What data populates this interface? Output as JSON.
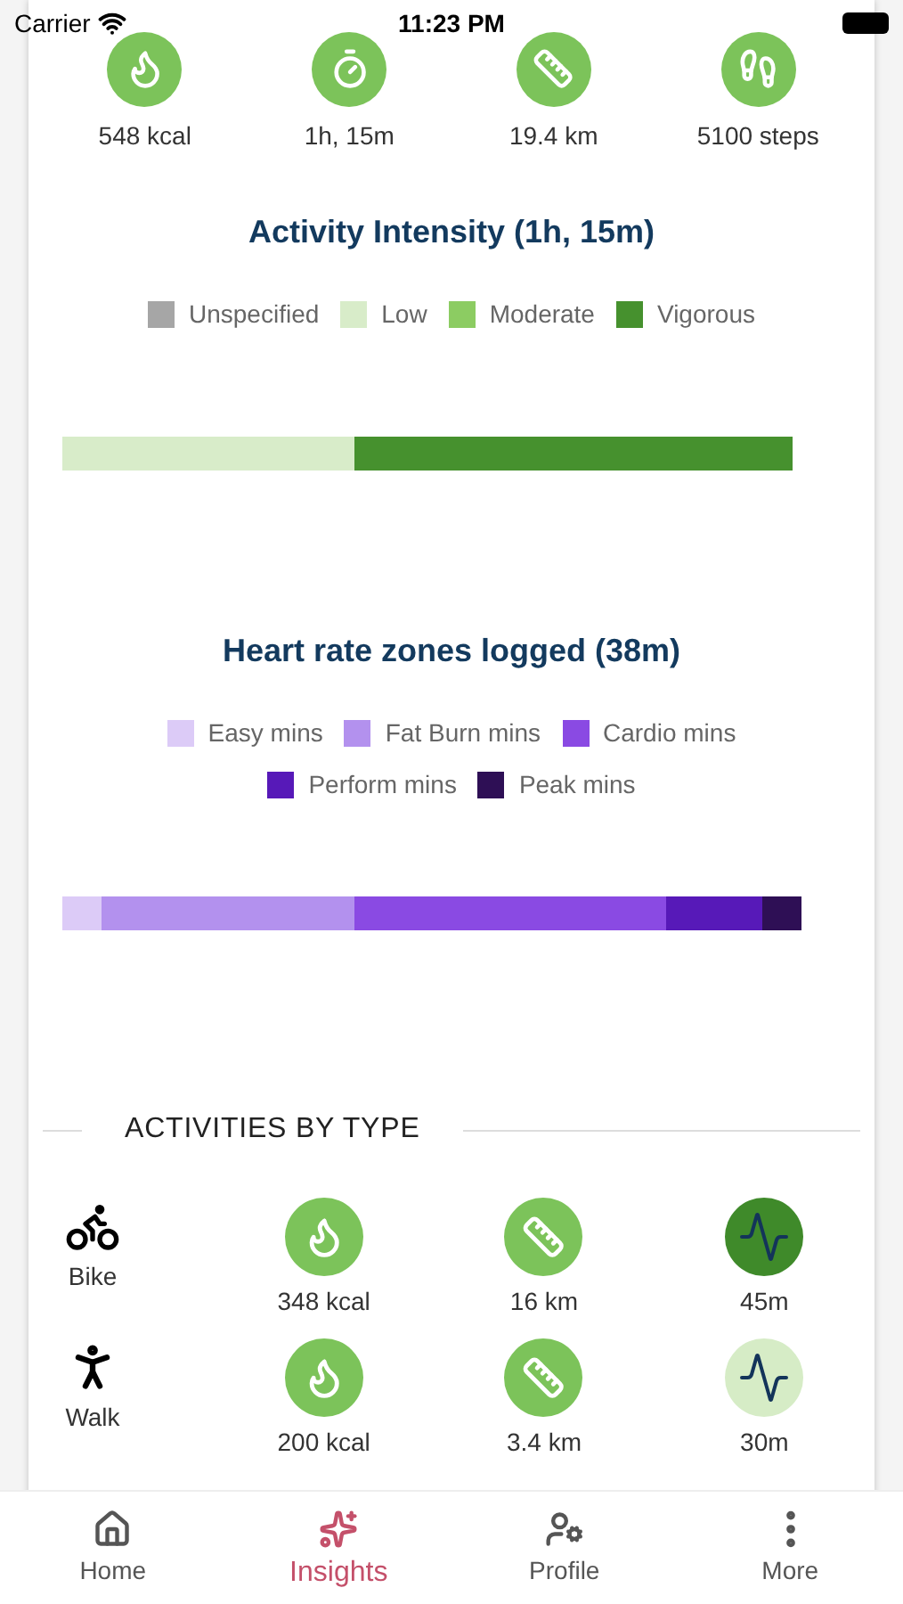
{
  "status_bar": {
    "carrier": "Carrier",
    "time": "11:23 PM"
  },
  "summary": [
    {
      "kind": "calories",
      "value": "548 kcal"
    },
    {
      "kind": "duration",
      "value": "1h, 15m"
    },
    {
      "kind": "distance",
      "value": "19.4 km"
    },
    {
      "kind": "steps",
      "value": "5100 steps"
    }
  ],
  "intensity": {
    "title": "Activity Intensity (1h, 15m)",
    "legend": [
      {
        "label": "Unspecified",
        "color": "#a6a6a6"
      },
      {
        "label": "Low",
        "color": "#d8ecc9"
      },
      {
        "label": "Moderate",
        "color": "#8ccc62"
      },
      {
        "label": "Vigorous",
        "color": "#46912e"
      }
    ]
  },
  "heart_rate": {
    "title": "Heart rate zones logged (38m)",
    "legend": [
      {
        "label": "Easy mins",
        "color": "#dccbf7"
      },
      {
        "label": "Fat Burn mins",
        "color": "#b391ee"
      },
      {
        "label": "Cardio mins",
        "color": "#8a4ae3"
      },
      {
        "label": "Perform mins",
        "color": "#5719b8"
      },
      {
        "label": "Peak mins",
        "color": "#2e0f55"
      }
    ]
  },
  "activities": {
    "title": "ACTIVITIES BY TYPE",
    "rows": [
      {
        "kind": "bike",
        "name": "Bike",
        "calories": "348 kcal",
        "distance": "16 km",
        "duration": "45m",
        "color": "#3f8a2a"
      },
      {
        "kind": "walk",
        "name": "Walk",
        "calories": "200 kcal",
        "distance": "3.4 km",
        "duration": "30m",
        "color": "#d6ecc6"
      }
    ]
  },
  "tabs": [
    {
      "kind": "home",
      "label": "Home",
      "selected": false
    },
    {
      "kind": "insights",
      "label": "Insights",
      "selected": true
    },
    {
      "kind": "profile",
      "label": "Profile",
      "selected": false
    },
    {
      "kind": "more",
      "label": "More",
      "selected": false
    }
  ]
}
